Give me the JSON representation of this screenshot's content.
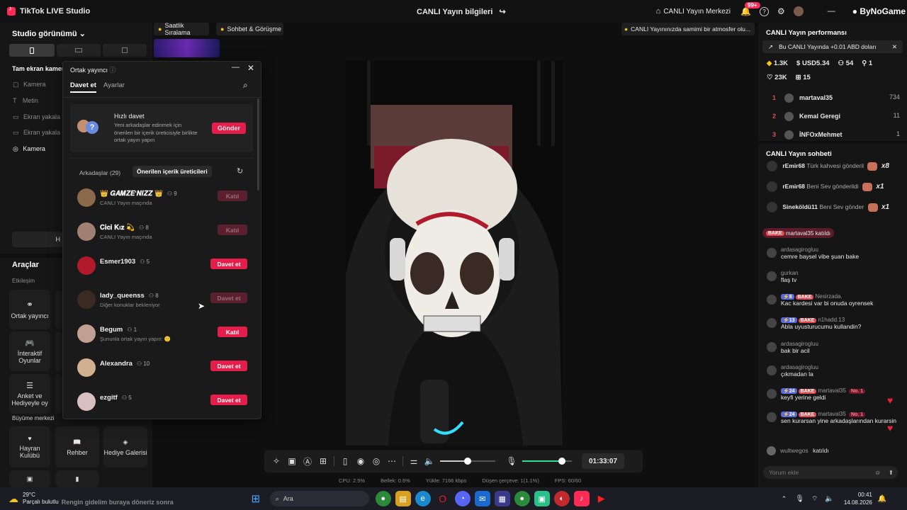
{
  "app": {
    "title": "TikTok LIVE Studio",
    "center_title": "CANLI Yayın bilgileri",
    "live_center": "CANLI Yayın Merkezi",
    "notif_badge": "99+",
    "watermark": "ByNoGame"
  },
  "left": {
    "studio_view": "Studio görünümü",
    "fullscreen_cam": "Tam ekran kamer",
    "sources": [
      "Kamera",
      "Metin",
      "Ekran yakala",
      "Ekran yakala",
      "Kamera"
    ],
    "tools_title": "Araçlar",
    "engagement": "Etkileşim",
    "tools": [
      "Ortak yayıncı",
      "İnteraktif Oyunlar",
      "Anket ve Hediyeyle oy"
    ],
    "growth_title": "Büyüme merkezi",
    "growth": [
      "Hayran Kulübü",
      "Rehber",
      "Hediye Galerisi"
    ],
    "h_label": "H"
  },
  "top_chips": {
    "ranking": "Saatlik Sıralama",
    "chat": "Sohbet & Görüşme",
    "tip": "CANLI Yayınınızda samimi bir atmosfer olu..."
  },
  "popup": {
    "title": "Ortak yayıncı",
    "tabs": [
      "Davet et",
      "Ayarlar"
    ],
    "quick": {
      "title": "Hızlı davet",
      "desc": "Yeni arkadaşlar edinmek için önerilen bir içerik üreticisiyle birlikte ortak yayın yapın",
      "button": "Gönder"
    },
    "friends_tab": "Arkadaşlar (29)",
    "suggested_tab": "Önerilen içerik üreticileri",
    "users": [
      {
        "name": "👑 𝑮𝑨𝑴𝒁𝑬'𝑵𝑰𝒁𝒁 👑",
        "count": "9",
        "sub": "CANLI Yayın maçında",
        "button": "Katıl",
        "active": false,
        "color": "#8a6a4a"
      },
      {
        "name": "𝐂𝐢𝐜𝐢 𝐊ı𝐳 💫",
        "count": "8",
        "sub": "CANLI Yayın maçında",
        "button": "Katıl",
        "active": false,
        "color": "#a08070"
      },
      {
        "name": "Esmer1903",
        "count": "5",
        "sub": "",
        "button": "Davet et",
        "active": true,
        "color": "#b01a2a"
      },
      {
        "name": "lady_queenss",
        "count": "8",
        "sub": "Diğer konuklar bekleniyor",
        "button": "Davet et",
        "active": false,
        "color": "#3a2a22"
      },
      {
        "name": "Begum",
        "count": "1",
        "sub": "Şununla ortak yayın yapın: 🙂",
        "button": "Katıl",
        "active": true,
        "color": "#c0a090"
      },
      {
        "name": "Alexandra",
        "count": "10",
        "sub": "",
        "button": "Davet et",
        "active": true,
        "color": "#d0b090"
      },
      {
        "name": "ezgitf",
        "count": "5",
        "sub": "",
        "button": "Davet et",
        "active": true,
        "color": "#d8c0c0"
      }
    ]
  },
  "controls": {
    "timer": "01:33:07",
    "mic_level": 0.8,
    "volume_level": 0.5
  },
  "stats": {
    "cpu": "CPU: 2.5%",
    "memory": "Bellek: 0.6%",
    "upload": "Yükle: 7166 kbps",
    "dropped": "Düşen çerçeve: 1(1.1%)",
    "fps": "FPS: 60/60"
  },
  "perf": {
    "title": "CANLI Yayın performansı",
    "banner": "Bu CANLI Yayında +0.01 ABD doları",
    "stat1": "1.3K",
    "stat2": "USD5.34",
    "stat3": "54",
    "stat4": "1",
    "stat5": "23K",
    "stat6": "15",
    "ranking": [
      {
        "rank": "1",
        "name": "martaval35",
        "score": "734"
      },
      {
        "rank": "2",
        "name": "Kemal Geregi",
        "score": "11"
      },
      {
        "rank": "3",
        "name": "İNFOxMehmet",
        "score": "1"
      }
    ]
  },
  "chat": {
    "title": "CANLI Yayın sohbeti",
    "gifts": [
      {
        "user": "rEmir68",
        "text": "Türk kahvesi gönderil",
        "mult": "x8"
      },
      {
        "user": "rEmir68",
        "text": "Beni Sev gönderildi",
        "mult": "x1"
      },
      {
        "user": "Sineköldü11",
        "text": "Beni Sev gönder",
        "mult": "x1"
      }
    ],
    "joined_banner": "martaval35 katıldı",
    "bake": "BAKE",
    "messages": [
      {
        "user": "ardasagirogluu",
        "text": "cemre baysel vibe şuan bake"
      },
      {
        "user": "gurkan",
        "text": "flaş tv"
      },
      {
        "user": "Nesirzada.",
        "text": "Kac kardesi var bi onuda oyrensek",
        "lvl": "8"
      },
      {
        "user": "n1hadd.13",
        "text": "Abla uyusturucumu kullandin?",
        "lvl": "13"
      },
      {
        "user": "ardasagirogluu",
        "text": "bak bir acil"
      },
      {
        "user": "ardasagirogluu",
        "text": "çıkmadan la"
      },
      {
        "user": "martaval35",
        "text": "keyfi yerine geldi",
        "lvl": "24",
        "no": "No. 1"
      },
      {
        "user": "martaval35",
        "text": "sen kurarsan yine arkadaşlarından kurarsin",
        "lvl": "24",
        "no": "No. 1"
      }
    ],
    "last_join_user": "wultwegos",
    "last_join_text": "katıldı",
    "input_placeholder": "Yorum ekle"
  },
  "taskbar": {
    "weather_temp": "29°C",
    "weather_desc": "Parçalı bulutlu",
    "overlay_text": "Rengin gidelim buraya döneriz sonra",
    "search": "Ara",
    "time": "00:41",
    "date": "14.08.2026"
  }
}
